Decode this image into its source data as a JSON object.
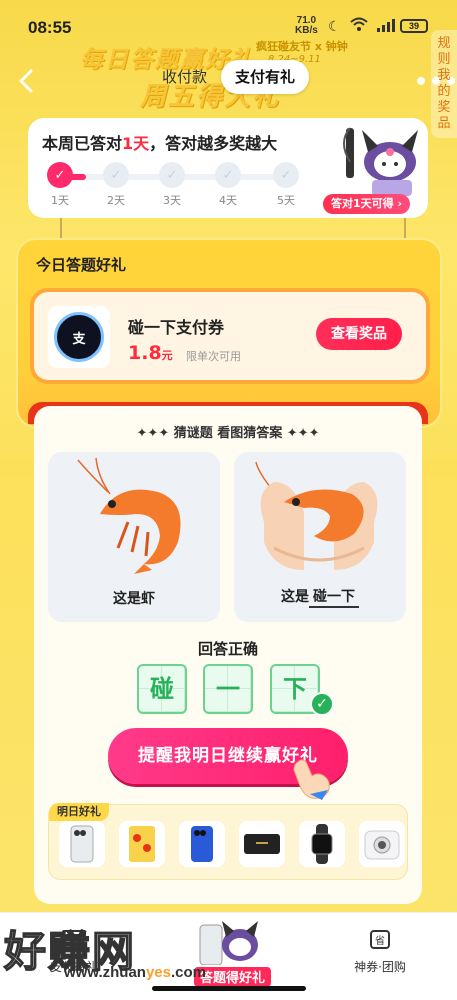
{
  "status_bar": {
    "time": "08:55",
    "net_speed": "71.0",
    "net_unit": "KB/s",
    "battery": "39"
  },
  "banner": {
    "title_line1": "每日答题赢好礼",
    "subtitle": "疯狂碰友节 x 钟钟",
    "date_range": "8.24~9.11",
    "title_line2": "周五得大礼"
  },
  "header": {
    "tabs": [
      {
        "label": "收付款",
        "active": false
      },
      {
        "label": "支付有礼",
        "active": true
      }
    ],
    "side_tag": "规则 我的奖品"
  },
  "weekly": {
    "title_prefix": "本周已答对",
    "title_days": "1天",
    "title_suffix": "，答对越多奖越大",
    "days": [
      "1天",
      "2天",
      "3天",
      "4天",
      "5天"
    ],
    "completed_days": 1,
    "badge": "答对1天可得 ›"
  },
  "today": {
    "title": "今日答题好礼",
    "coupon_name": "碰一下支付券",
    "coupon_amount": "1.8",
    "coupon_unit": "元",
    "coupon_limit": "限单次可用",
    "view_button": "查看奖品",
    "logo_text": "支"
  },
  "quiz": {
    "title": "✦✦✦ 猜谜题 看图猜答案 ✦✦✦",
    "left_caption": "这是虾",
    "right_caption_prefix": "这是",
    "right_caption_answer": "碰一下",
    "answer_title": "回答正确",
    "answer_chars": [
      "碰",
      "一",
      "下"
    ],
    "remind_button": "提醒我明日继续赢好礼"
  },
  "tomorrow": {
    "label": "明日好礼",
    "prizes": [
      "phone-white",
      "red-envelope",
      "phone-blue",
      "speaker",
      "smart-watch",
      "instant-camera"
    ]
  },
  "bottom_nav": {
    "left_label": "支付有礼",
    "center_label": "答题得好礼",
    "right_label": "神券·团购"
  },
  "watermark": {
    "text": "好赚网",
    "url_prefix": "www.zhuan",
    "url_accent": "yes",
    "url_suffix": ".com"
  },
  "colors": {
    "accent_red": "#ff2a3c",
    "accent_pink": "#ff2a6b",
    "correct_green": "#27b25a",
    "background_yellow": "#fbe25a"
  }
}
